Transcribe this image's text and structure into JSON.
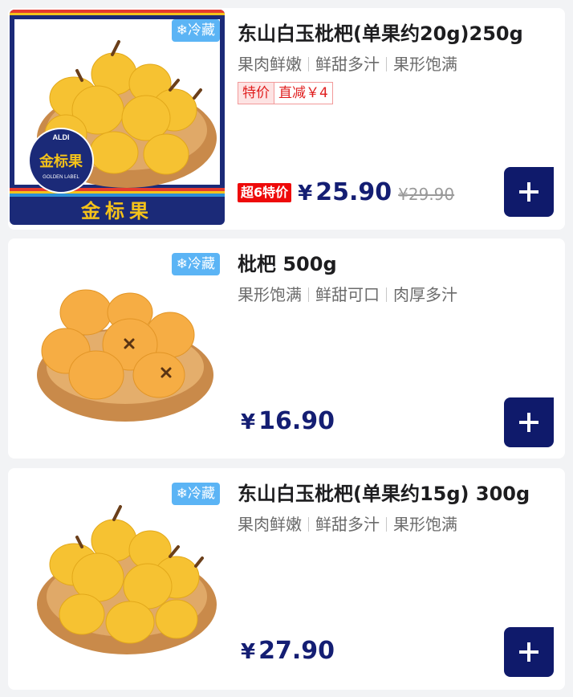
{
  "products": [
    {
      "cold_label": "❄冷藏",
      "title": "东山白玉枇杷(单果约20g)250g",
      "features": [
        "果肉鲜嫩",
        "鲜甜多汁",
        "果形饱满"
      ],
      "promo": {
        "label": "特价",
        "value": "直减￥4"
      },
      "sale_badge": "超6特价",
      "currency": "¥",
      "price": "25.90",
      "old_price": "¥29.90",
      "banner": {
        "text": "金标果",
        "seal_brand": "ALDI",
        "seal_text": "金标果",
        "seal_sub": "GOLDEN LABEL"
      },
      "image": "yellow-loquats-in-wooden-bowl"
    },
    {
      "cold_label": "❄冷藏",
      "title": "枇杷 500g",
      "features": [
        "果形饱满",
        "鲜甜可口",
        "肉厚多汁"
      ],
      "currency": "¥",
      "price": "16.90",
      "image": "orange-loquats-in-wooden-bowl"
    },
    {
      "cold_label": "❄冷藏",
      "title": "东山白玉枇杷(单果约15g) 300g",
      "features": [
        "果肉鲜嫩",
        "鲜甜多汁",
        "果形饱满"
      ],
      "currency": "¥",
      "price": "27.90",
      "image": "yellow-loquats-in-wooden-bowl"
    }
  ],
  "colors": {
    "price": "#141e73",
    "add_button": "#0f1a6b",
    "cold_tag": "#5bb4f5",
    "sale": "#ee0a0a",
    "banner_bg": "#1b2a78",
    "banner_text": "#f4c21a"
  },
  "icons": {
    "add": "plus-icon"
  }
}
